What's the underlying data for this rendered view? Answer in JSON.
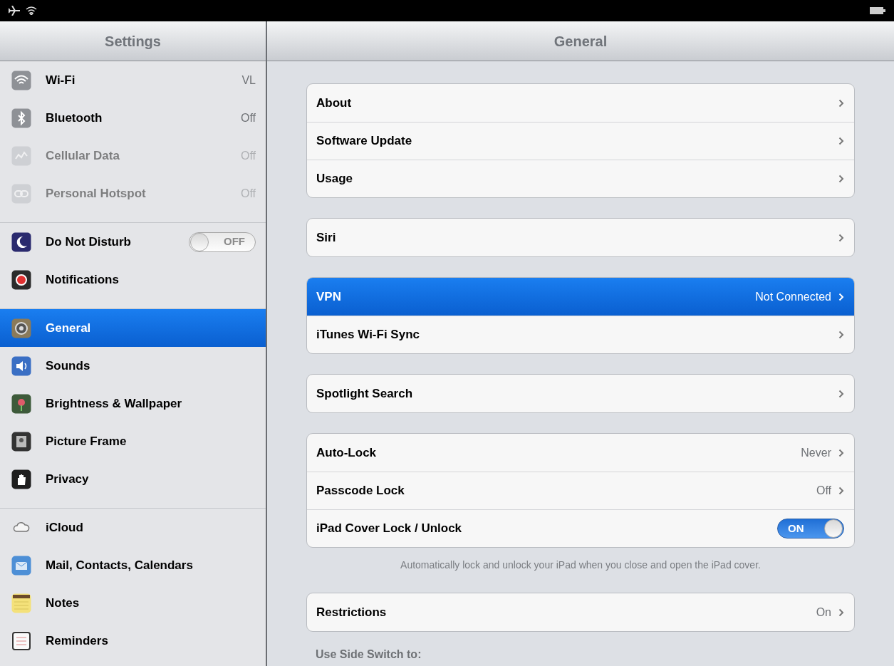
{
  "sidebar": {
    "title": "Settings",
    "groups": [
      {
        "items": [
          {
            "label": "Wi-Fi",
            "kind": "value",
            "value": "VL",
            "disabled": false,
            "selected": false
          },
          {
            "label": "Bluetooth",
            "kind": "value",
            "value": "Off",
            "disabled": false,
            "selected": false
          },
          {
            "label": "Cellular Data",
            "kind": "value",
            "value": "Off",
            "disabled": true,
            "selected": false
          },
          {
            "label": "Personal Hotspot",
            "kind": "value",
            "value": "Off",
            "disabled": true,
            "selected": false
          }
        ]
      },
      {
        "items": [
          {
            "label": "Do Not Disturb",
            "kind": "toggle",
            "on": false,
            "toggle_text": "OFF",
            "disabled": false,
            "selected": false
          },
          {
            "label": "Notifications",
            "kind": "plain",
            "disabled": false,
            "selected": false
          }
        ]
      },
      {
        "items": [
          {
            "label": "General",
            "kind": "plain",
            "disabled": false,
            "selected": true
          },
          {
            "label": "Sounds",
            "kind": "plain",
            "disabled": false,
            "selected": false
          },
          {
            "label": "Brightness & Wallpaper",
            "kind": "plain",
            "disabled": false,
            "selected": false
          },
          {
            "label": "Picture Frame",
            "kind": "plain",
            "disabled": false,
            "selected": false
          },
          {
            "label": "Privacy",
            "kind": "plain",
            "disabled": false,
            "selected": false
          }
        ]
      },
      {
        "items": [
          {
            "label": "iCloud",
            "kind": "plain",
            "disabled": false,
            "selected": false
          },
          {
            "label": "Mail, Contacts, Calendars",
            "kind": "plain",
            "disabled": false,
            "selected": false
          },
          {
            "label": "Notes",
            "kind": "plain",
            "disabled": false,
            "selected": false
          },
          {
            "label": "Reminders",
            "kind": "plain",
            "disabled": false,
            "selected": false
          }
        ]
      }
    ]
  },
  "detail": {
    "title": "General",
    "groups": [
      {
        "rows": [
          {
            "label": "About",
            "kind": "link",
            "selected": false
          },
          {
            "label": "Software Update",
            "kind": "link",
            "selected": false
          },
          {
            "label": "Usage",
            "kind": "link",
            "selected": false
          }
        ]
      },
      {
        "rows": [
          {
            "label": "Siri",
            "kind": "link",
            "selected": false
          }
        ]
      },
      {
        "rows": [
          {
            "label": "VPN",
            "kind": "link",
            "value": "Not Connected",
            "selected": true
          },
          {
            "label": "iTunes Wi-Fi Sync",
            "kind": "link",
            "selected": false
          }
        ]
      },
      {
        "rows": [
          {
            "label": "Spotlight Search",
            "kind": "link",
            "selected": false
          }
        ]
      },
      {
        "rows": [
          {
            "label": "Auto-Lock",
            "kind": "link",
            "value": "Never",
            "selected": false
          },
          {
            "label": "Passcode Lock",
            "kind": "link",
            "value": "Off",
            "selected": false
          },
          {
            "label": "iPad Cover Lock / Unlock",
            "kind": "toggle",
            "on": true,
            "toggle_text": "ON",
            "selected": false
          }
        ],
        "footer": "Automatically lock and unlock your iPad when you close and open the iPad cover."
      },
      {
        "rows": [
          {
            "label": "Restrictions",
            "kind": "link",
            "value": "On",
            "selected": false
          }
        ]
      },
      {
        "header": "Use Side Switch to:"
      }
    ]
  }
}
